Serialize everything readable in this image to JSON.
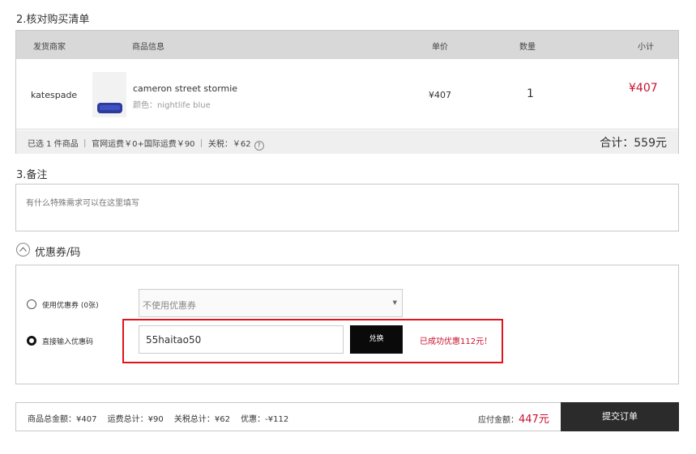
{
  "sections": {
    "order_title": "2.核对购买清单",
    "remark_title": "3.备注",
    "coupon_title": "优惠券/码"
  },
  "table": {
    "headers": [
      "发货商家",
      "商品信息",
      "单价",
      "数量",
      "小计"
    ],
    "row": {
      "seller": "katespade",
      "product_name": "cameron street stormie",
      "product_color": "颜色：nightlife blue",
      "unit_price": "¥407",
      "quantity": "1",
      "subtotal": "¥407"
    },
    "summary": "已选 1 件商品 ｜ 官网运费￥0+国际运费￥90 ｜ 关税：￥62",
    "help_symbol": "?",
    "total": "合计：559元"
  },
  "remark": {
    "placeholder": "有什么特殊需求可以在这里填写"
  },
  "coupon": {
    "use_coupon_label": "使用优惠券 (0张)",
    "select_value": "不使用优惠券",
    "caret": "▼",
    "direct_code_label": "直接输入优惠码",
    "code_value": "55haitao50",
    "exchange_label": "兑换",
    "success_message": "已成功优惠112元！"
  },
  "bottom": {
    "totals": "商品总金额：¥407　 运费总计：¥90　 关税总计：¥62　 优惠：-¥112",
    "payable_label": "应付金额：",
    "payable_amount": "447元",
    "submit_label": "提交订单"
  },
  "colors": {
    "accent_red": "#c8102e",
    "highlight_frame": "#e1141b",
    "submit_bg": "#2b2b2b"
  }
}
